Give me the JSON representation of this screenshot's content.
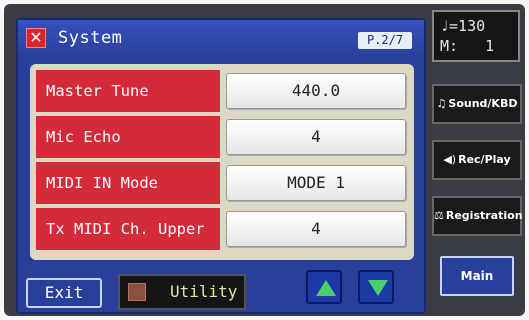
{
  "window": {
    "title": "System",
    "page_indicator": "P.2/7",
    "close_symbol": "✕"
  },
  "parameters": [
    {
      "label": "Master Tune",
      "value": "440.0"
    },
    {
      "label": "Mic Echo",
      "value": "4"
    },
    {
      "label": "MIDI IN Mode",
      "value": "MODE 1"
    },
    {
      "label": "Tx MIDI Ch. Upper",
      "value": "4"
    }
  ],
  "bottom_bar": {
    "exit_label": "Exit",
    "utility_label": "Utility",
    "up_icon": "up-arrow-icon",
    "down_icon": "down-arrow-icon"
  },
  "status": {
    "tempo_line": "♩=130",
    "measure_line": "M:   1"
  },
  "sidebar": {
    "sound_kbd": {
      "icon": "♫",
      "label": "Sound/KBD"
    },
    "rec_play": {
      "icon": "◀)",
      "label": "Rec/Play"
    },
    "registration": {
      "icon": "⚖",
      "label": "Registration"
    },
    "main_label": "Main"
  },
  "colors": {
    "panel_blue": "#2a3f9a",
    "label_red": "#d42a3a",
    "arrow_green": "#4ad06a",
    "close_red": "#d8262a"
  }
}
